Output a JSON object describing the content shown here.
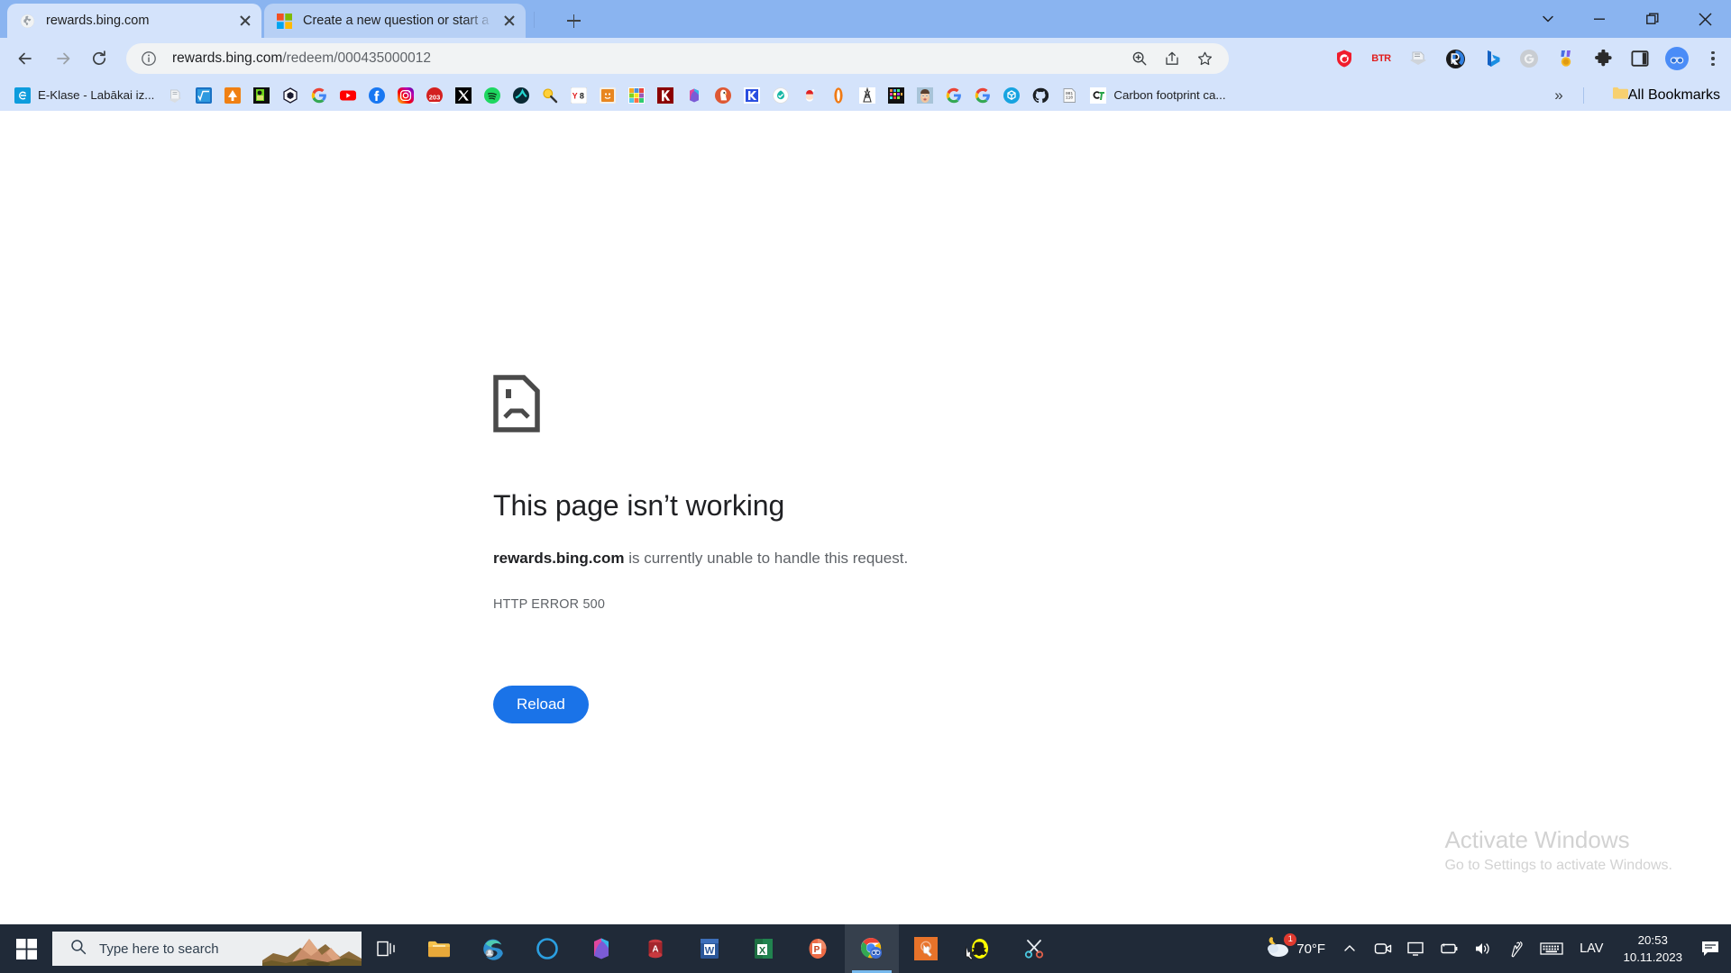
{
  "window": {
    "controls": {
      "tab_search": "tab-search",
      "minimize": "minimize",
      "maximize": "maximize",
      "close": "close"
    }
  },
  "tabs": [
    {
      "title": "rewards.bing.com",
      "favicon": "globe-icon",
      "active": true
    },
    {
      "title": "Create a new question or start a",
      "favicon": "microsoft-icon",
      "active": false
    }
  ],
  "newtab_label": "+",
  "toolbar": {
    "back": "back-icon",
    "forward": "forward-icon",
    "reload": "reload-icon",
    "site_info": "info-icon",
    "url_host": "rewards.bing.com",
    "url_path": "/redeem/000435000012",
    "url_full": "rewards.bing.com/redeem/000435000012",
    "actions": [
      "zoom-icon",
      "share-icon",
      "bookmark-star-icon"
    ],
    "extensions": [
      "opera-gx-shield-icon",
      "btr-text-icon",
      "grey-scanner-icon",
      "r-circle-icon",
      "bing-b-icon",
      "g-grey-icon",
      "medal-icon",
      "puzzle-extensions-icon",
      "side-panel-icon",
      "profile-avatar-icon"
    ],
    "menu": "three-dot-menu-icon"
  },
  "bookmarks": {
    "items": [
      {
        "label": "E-Klase - Labākai iz...",
        "icon": "eklase-icon"
      },
      {
        "label": "",
        "icon": "grey-file-icon"
      },
      {
        "label": "",
        "icon": "math-formula-icon"
      },
      {
        "label": "",
        "icon": "orange-tree-icon"
      },
      {
        "label": "",
        "icon": "green-character-icon"
      },
      {
        "label": "",
        "icon": "hexagon-icon"
      },
      {
        "label": "",
        "icon": "google-icon"
      },
      {
        "label": "",
        "icon": "youtube-icon"
      },
      {
        "label": "",
        "icon": "facebook-icon"
      },
      {
        "label": "",
        "icon": "instagram-icon"
      },
      {
        "label": "",
        "icon": "203-red-icon"
      },
      {
        "label": "",
        "icon": "x-twitter-icon"
      },
      {
        "label": "",
        "icon": "spotify-icon"
      },
      {
        "label": "",
        "icon": "teal-check-icon"
      },
      {
        "label": "",
        "icon": "magnifier-pencil-icon"
      },
      {
        "label": "",
        "icon": "y8-icon"
      },
      {
        "label": "",
        "icon": "orange-book-icon"
      },
      {
        "label": "",
        "icon": "tinkercad-icon"
      },
      {
        "label": "",
        "icon": "kahoot-k-icon"
      },
      {
        "label": "",
        "icon": "office-365-icon"
      },
      {
        "label": "",
        "icon": "duckduckgo-icon"
      },
      {
        "label": "",
        "icon": "klase-k-icon"
      },
      {
        "label": "",
        "icon": "teal-drop-icon"
      },
      {
        "label": "",
        "icon": "santa-icon"
      },
      {
        "label": "",
        "icon": "orange-pill-icon"
      },
      {
        "label": "",
        "icon": "tower-icon"
      },
      {
        "label": "",
        "icon": "pixel-grid-icon"
      },
      {
        "label": "",
        "icon": "photo-face-icon"
      },
      {
        "label": "",
        "icon": "google-icon-2"
      },
      {
        "label": "",
        "icon": "google-icon-3"
      },
      {
        "label": "",
        "icon": "blue-box-icon"
      },
      {
        "label": "",
        "icon": "github-icon"
      },
      {
        "label": "",
        "icon": "binary-page-icon"
      },
      {
        "label": "Carbon footprint ca...",
        "icon": "ci-green-icon"
      }
    ],
    "overflow": "»",
    "all_bookmarks_label": "All Bookmarks",
    "all_bookmarks_icon": "folder-icon"
  },
  "error_page": {
    "icon": "sad-page-icon",
    "title": "This page isn’t working",
    "host": "rewards.bing.com",
    "message_rest": " is currently unable to handle this request.",
    "code": "HTTP ERROR 500",
    "reload_label": "Reload",
    "accent_color": "#1a73e8"
  },
  "watermark": {
    "title": "Activate Windows",
    "subtitle": "Go to Settings to activate Windows."
  },
  "taskbar": {
    "start": "windows-start-icon",
    "search": {
      "icon": "search-icon",
      "placeholder": "Type here to search",
      "thumbnail": "mountains-thumbnail"
    },
    "task_view": "task-view-icon",
    "apps": [
      {
        "name": "file-explorer",
        "active": false
      },
      {
        "name": "microsoft-edge",
        "active": false
      },
      {
        "name": "cortana",
        "active": false
      },
      {
        "name": "office-365",
        "active": false
      },
      {
        "name": "microsoft-access",
        "active": false
      },
      {
        "name": "microsoft-word",
        "active": false
      },
      {
        "name": "microsoft-excel",
        "active": false
      },
      {
        "name": "microsoft-powerpoint",
        "active": false
      },
      {
        "name": "google-chrome",
        "active": true
      },
      {
        "name": "orange-cursor-app",
        "active": false
      },
      {
        "name": "snapchat",
        "active": false
      },
      {
        "name": "snip-and-sketch",
        "active": false
      }
    ],
    "tray": {
      "weather_icon": "weather-partly-cloudy-night-icon",
      "weather_badge": "1",
      "temperature": "70°F",
      "overflow": "show-hidden-icons-chevron",
      "icons": [
        "camera-icon",
        "display-icon",
        "battery-icon",
        "volume-icon",
        "pen-icon",
        "keyboard-icon"
      ],
      "language": "LAV",
      "time": "20:53",
      "date": "10.11.2023",
      "notifications": "action-center-icon"
    }
  }
}
